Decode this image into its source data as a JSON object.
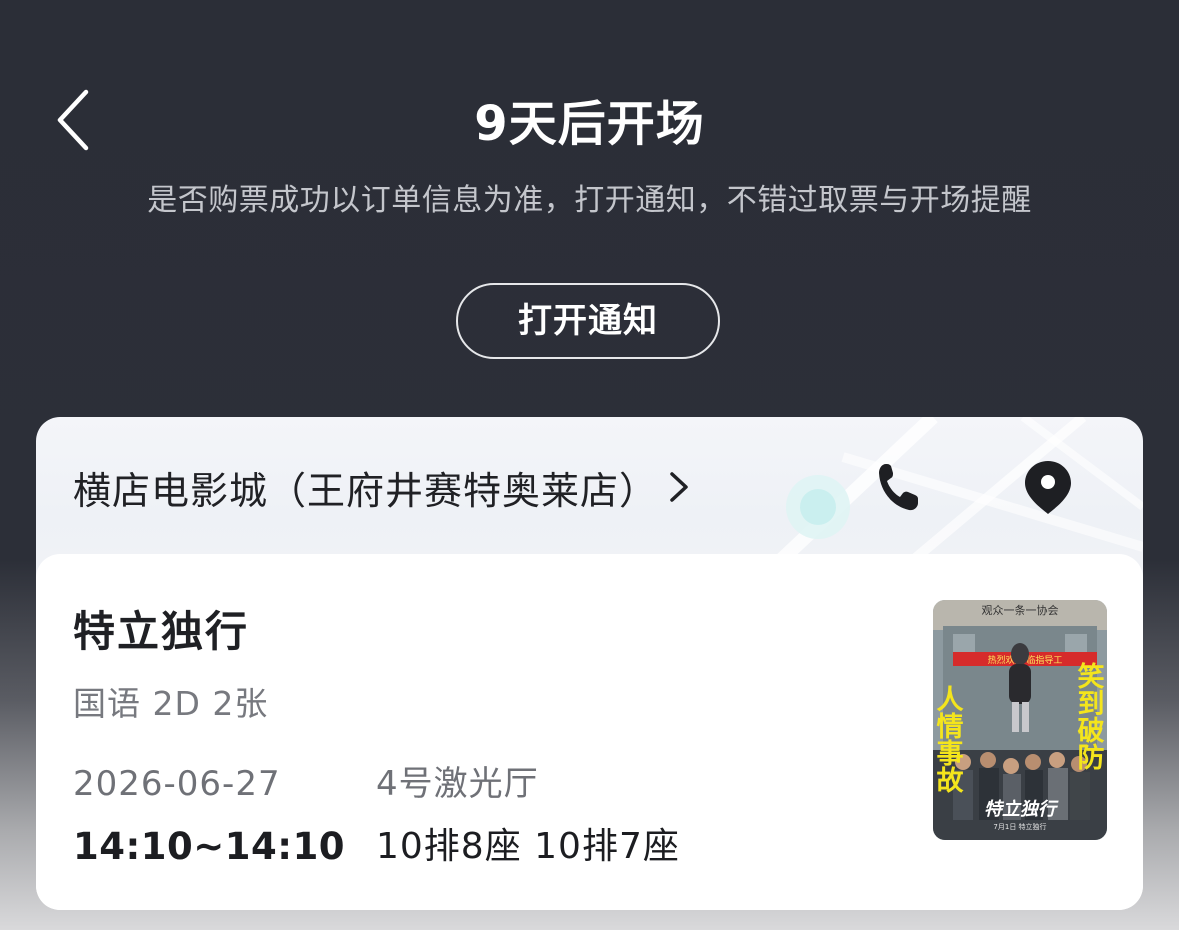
{
  "header": {
    "back_icon": "chevron-left-icon",
    "title": "9天后开场",
    "subtitle": "是否购票成功以订单信息为准，打开通知，不错过取票与开场提醒",
    "notify_button_label": "打开通知"
  },
  "cinema": {
    "name": "横店电影城（王府井赛特奥莱店）",
    "chevron_icon": "chevron-right-icon",
    "phone_icon": "phone-icon",
    "location_icon": "location-pin-icon"
  },
  "ticket": {
    "movie_title": "特立独行",
    "info": "国语 2D 2张",
    "date": "2026-06-27",
    "time": "14:10~14:10",
    "hall": "4号激光厅",
    "seats": "10排8座 10排7座"
  },
  "poster": {
    "top_banner": "观众一条一协会",
    "red_banner": "热烈欢迎  临指导工",
    "left_text": "人情事故",
    "right_text": "笑到破防",
    "logo_text": "特立独行",
    "release_text": "7月1日 特立独行"
  },
  "colors": {
    "background": "#2b2e37",
    "card": "#ffffff",
    "poster_yellow": "#f4e51c"
  }
}
